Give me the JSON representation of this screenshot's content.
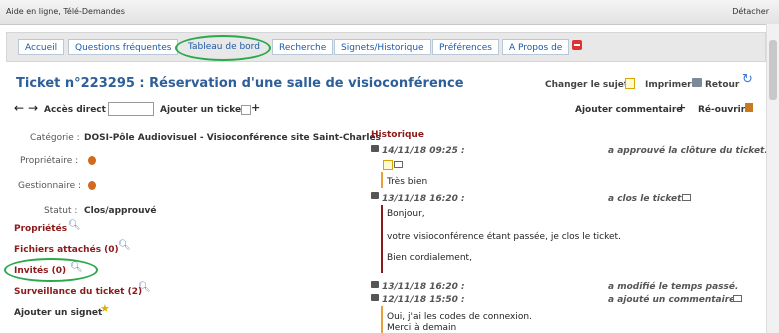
{
  "window": {
    "title": "Aide en ligne, Télé-Demandes",
    "detach_label": "Détacher"
  },
  "nav": {
    "items": [
      {
        "label": "Accueil"
      },
      {
        "label": "Questions fréquentes"
      },
      {
        "label": "Tableau de bord"
      },
      {
        "label": "Recherche"
      },
      {
        "label": "Signets/Historique"
      },
      {
        "label": "Préférences"
      },
      {
        "label": "A Propos de"
      }
    ]
  },
  "ticket": {
    "title": "Ticket n°223295 : Réservation d'une salle de visioconférence",
    "change_subject": "Changer le sujet",
    "print": "Imprimer",
    "back": "Retour",
    "direct_access_label": "Accès direct :",
    "direct_access_value": "",
    "add_ticket": "Ajouter un ticket",
    "add_comment": "Ajouter commentaire",
    "reopen": "Ré-ouvrir",
    "category_label": "Catégorie :",
    "category_value": "DOSI-Pôle Audiovisuel - Visioconférence site Saint-Charles",
    "owner_label": "Propriétaire :",
    "manager_label": "Gestionnaire :",
    "status_label": "Statut :",
    "status_value": "Clos/approuvé"
  },
  "sections": {
    "properties": "Propriétés",
    "attachments": "Fichiers attachés (0)",
    "guests": "Invités (0)",
    "watch": "Surveillance du ticket (2)",
    "bookmark": "Ajouter un signet"
  },
  "history": {
    "heading": "Historique",
    "entries": [
      {
        "meta": "14/11/18 09:25 :",
        "action": "a approuvé la clôture du ticket.",
        "lines": [
          "Très bien"
        ]
      },
      {
        "meta": "13/11/18 16:20 :",
        "action": "a clos le ticket.",
        "lines": [
          "Bonjour,",
          "votre visioconférence étant passée, je clos le ticket.",
          "Bien cordialement,"
        ]
      },
      {
        "meta": "13/11/18 16:20 :",
        "action": "a modifié le temps passé.",
        "lines": []
      },
      {
        "meta": "12/11/18 15:50 :",
        "action": "a ajouté un commentaire.",
        "lines": [
          "Oui, j'ai les codes de connexion.",
          "Merci à demain"
        ]
      }
    ]
  },
  "colors": {
    "accent": "#1d5aa8",
    "section": "#8b1a1a",
    "highlight": "#2aa84a",
    "history_bar_orange": "#e8a13a",
    "history_bar_red": "#8b1a1a"
  }
}
